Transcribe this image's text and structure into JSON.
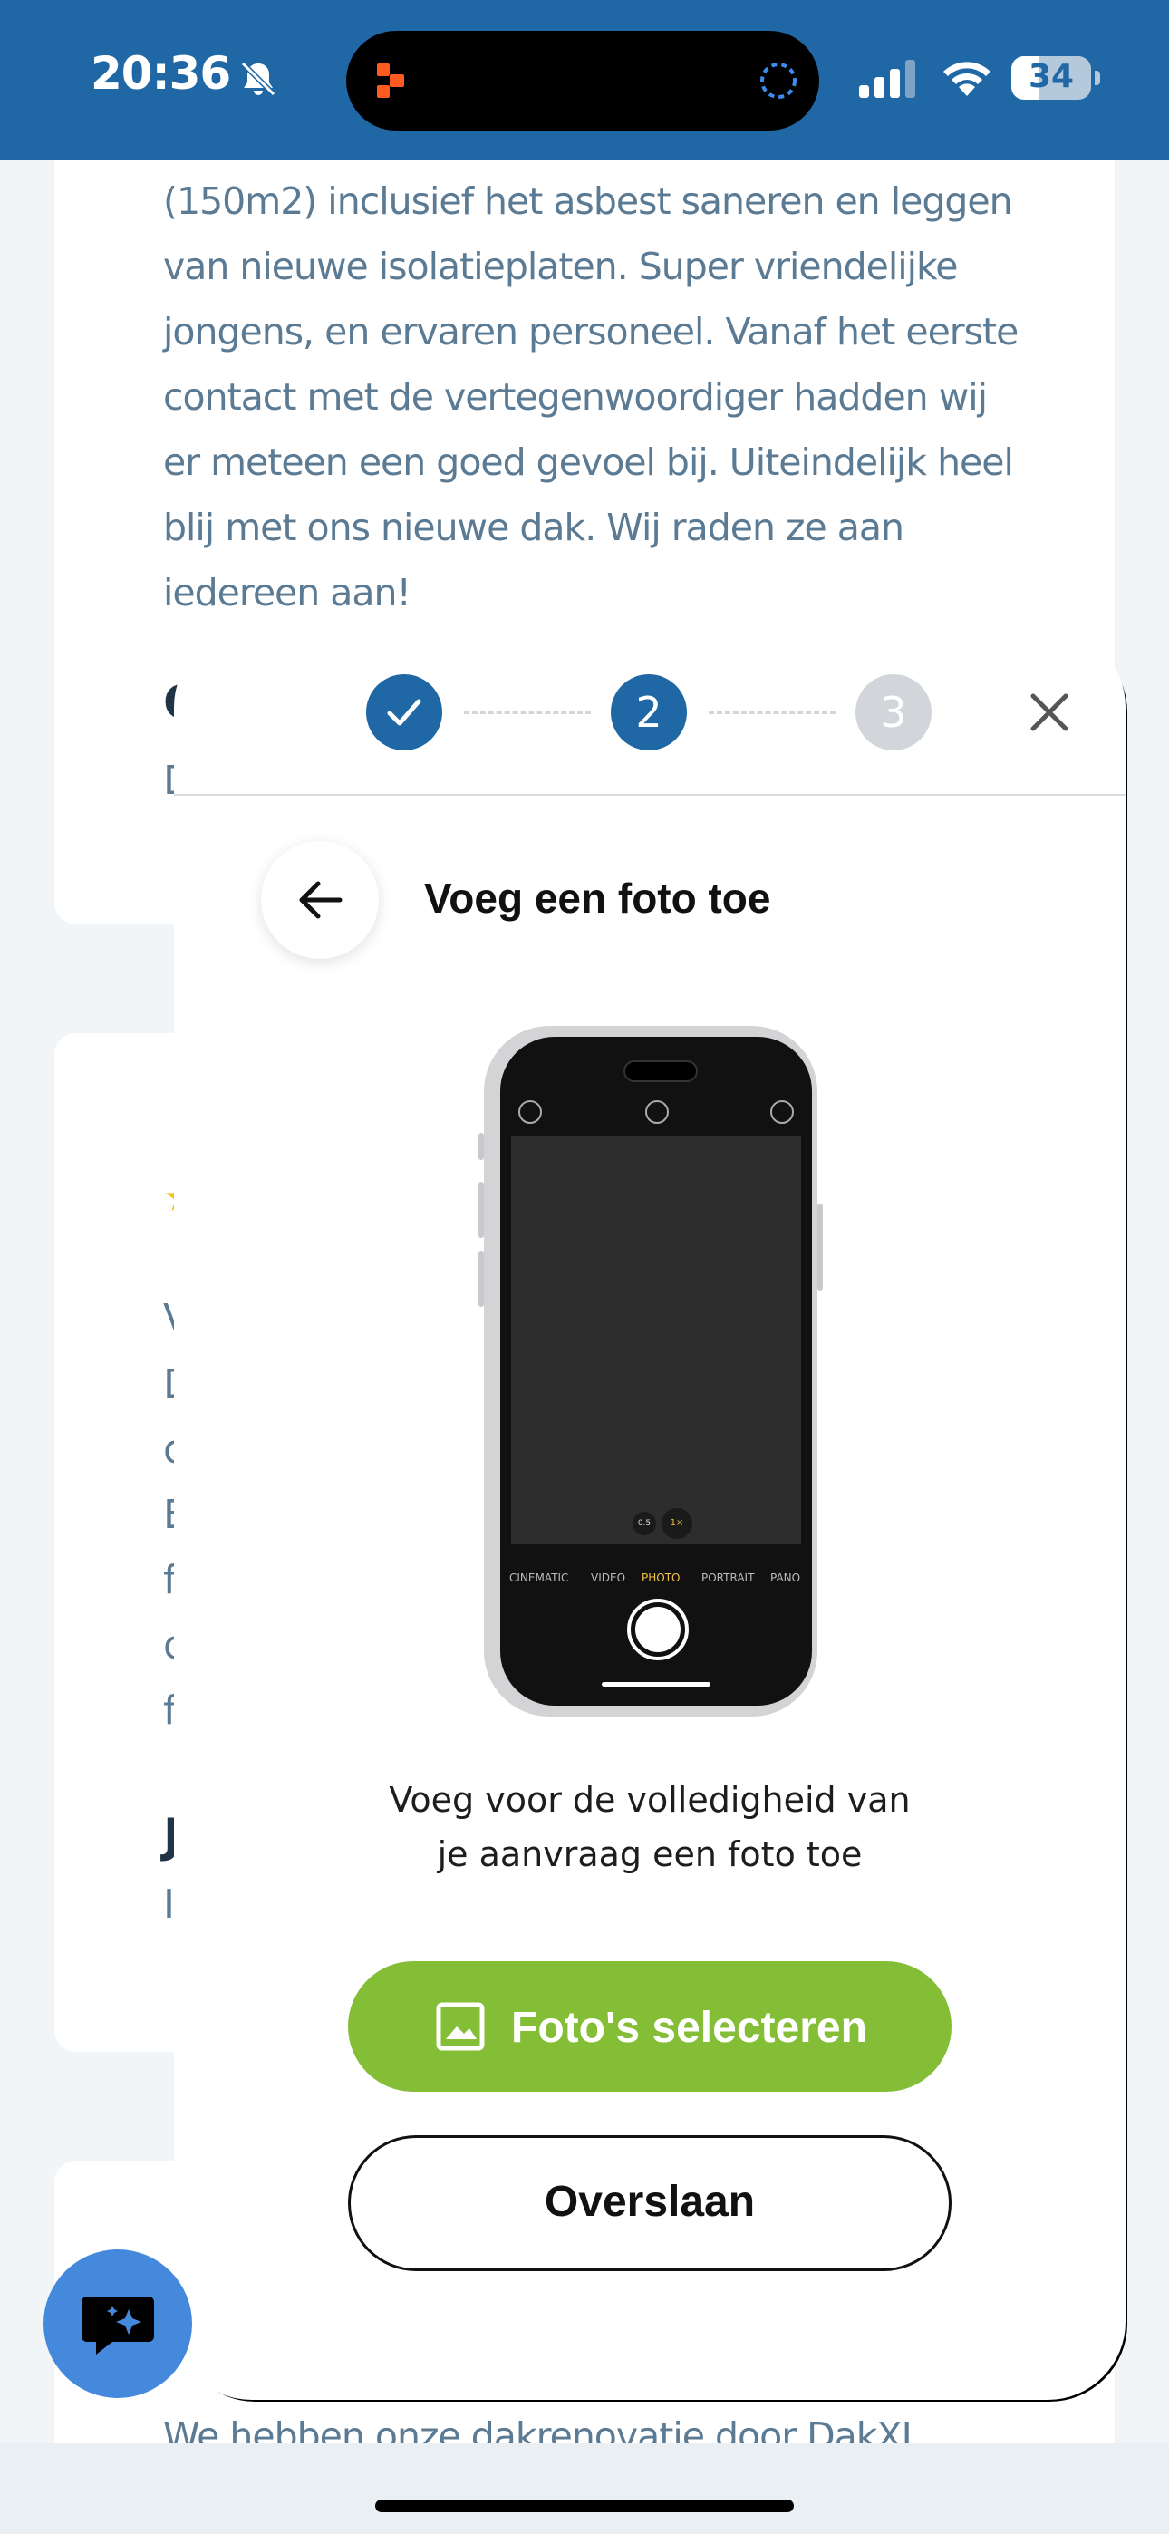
{
  "status_bar": {
    "time": "20:36",
    "battery": "34",
    "battery_level": 0.34,
    "icons": [
      "bell-slash-icon",
      "signal-icon",
      "wifi-icon",
      "battery-icon"
    ]
  },
  "colors": {
    "brand_blue": "#2068a5",
    "accent_green": "#84bd36",
    "chat_blue": "#4589dc",
    "text_muted": "#5b7a93"
  },
  "background": {
    "review_text": "(150m2) inclusief het asbest saneren en leggen van nieuwe isolatieplaten. Super vriendelijke jongens, en ervaren personeel. Vanaf het eerste contact met de vertegenwoordiger hadden wij er meteen een goed gevoel bij. Uiteindelijk heel blij met ons nieuwe dak. Wij raden ze aan iedereen aan!",
    "fragments": [
      "C",
      "D",
      "★",
      "V",
      "D",
      "o",
      "E",
      "f",
      "o",
      "f",
      "J",
      "I"
    ],
    "bottom_text": "We hebben onze dakrenovatie door DakXL"
  },
  "modal": {
    "steps": [
      {
        "label": "",
        "state": "done"
      },
      {
        "label": "2",
        "state": "active"
      },
      {
        "label": "3",
        "state": "pending"
      }
    ],
    "title": "Voeg een foto toe",
    "description_line1": "Voeg voor de volledigheid van",
    "description_line2": "je aanvraag een foto toe",
    "select_button": "Foto's selecteren",
    "skip_button": "Overslaan"
  },
  "phone_illustration": {
    "modes": [
      "CINEMATIC",
      "VIDEO",
      "PHOTO",
      "PORTRAIT",
      "PANO"
    ],
    "active_mode": "PHOTO",
    "zoom_options": [
      "0.5",
      "1×"
    ]
  }
}
